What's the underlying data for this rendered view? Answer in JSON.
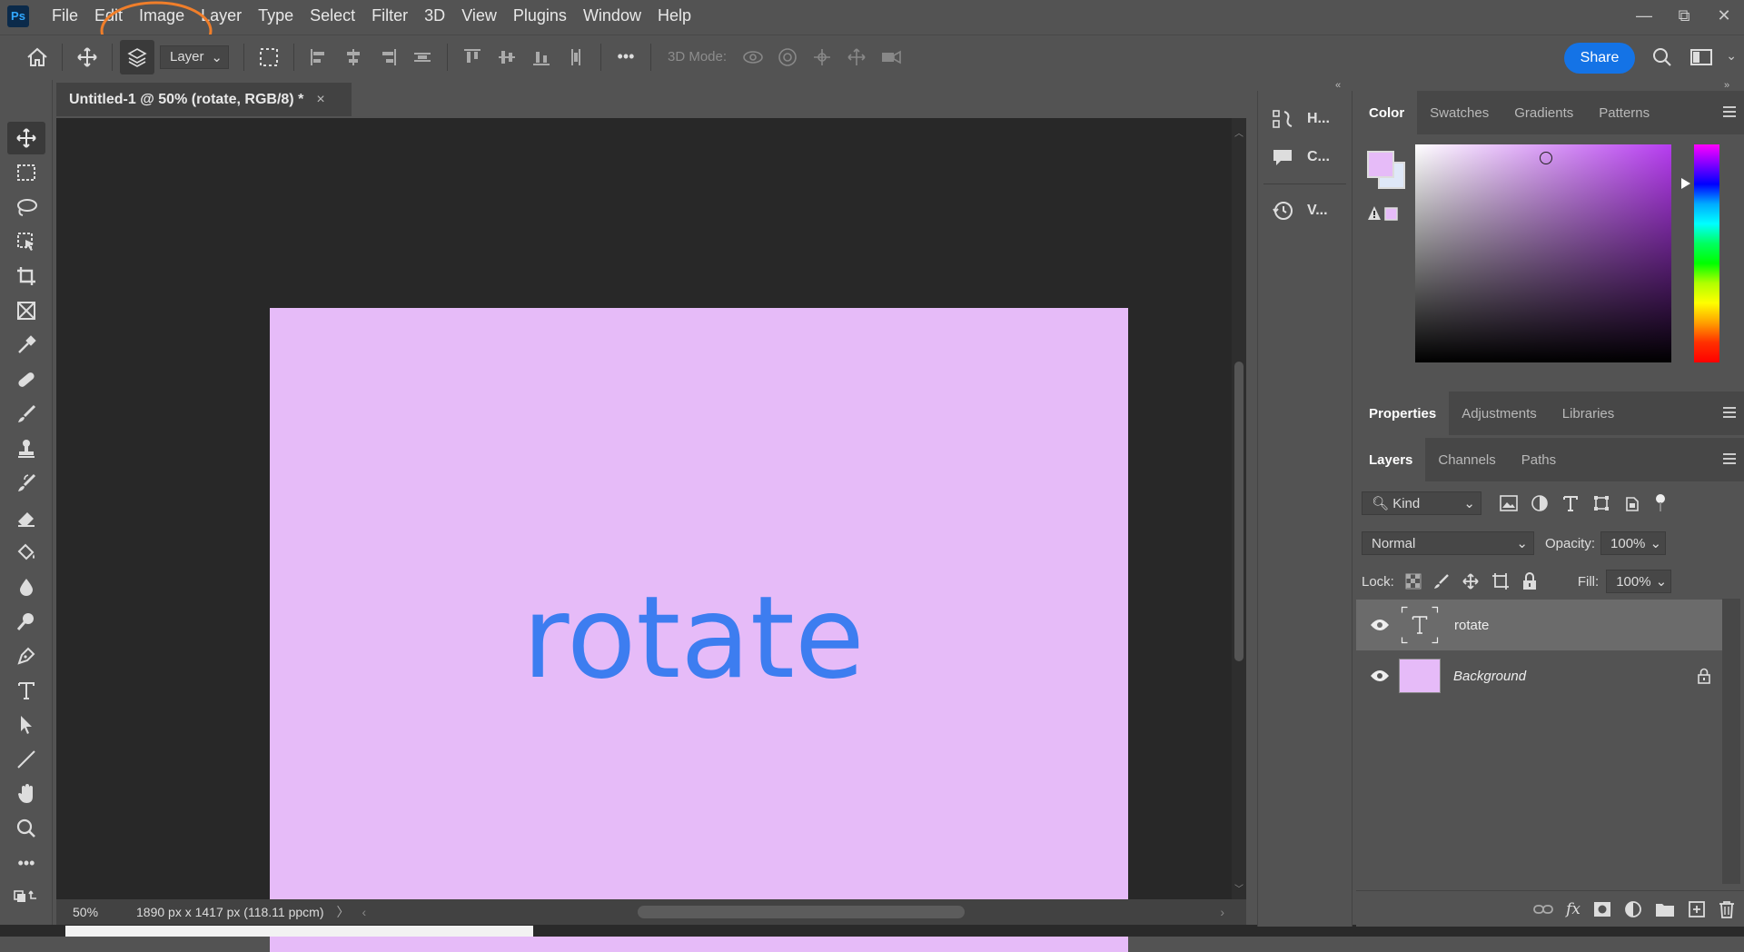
{
  "app": {
    "logo": "Ps"
  },
  "menu": [
    "File",
    "Edit",
    "Image",
    "Layer",
    "Type",
    "Select",
    "Filter",
    "3D",
    "View",
    "Plugins",
    "Window",
    "Help"
  ],
  "window_controls": {
    "minimize": "—",
    "restore": "⧉",
    "close": "✕"
  },
  "options": {
    "layer_select": "Layer",
    "mode_label": "3D Mode:",
    "more": "•••",
    "share": "Share"
  },
  "document": {
    "tab_title": "Untitled-1 @ 50% (rotate, RGB/8) *",
    "close": "×",
    "text": "rotate",
    "bg_color": "#e6bbf8",
    "text_color": "#3d7df0"
  },
  "status": {
    "zoom": "50%",
    "size": "1890 px x 1417 px (118.11 ppcm)",
    "arrow": "〉"
  },
  "panel_strip": [
    {
      "icon": "histogram-icon",
      "label": "H..."
    },
    {
      "icon": "comment-icon",
      "label": "C..."
    },
    {
      "icon": "history-icon",
      "label": "V..."
    }
  ],
  "color_panel": {
    "tabs": [
      "Color",
      "Swatches",
      "Gradients",
      "Patterns"
    ],
    "foreground": "#e6bbf8",
    "background": "#dfe8f8"
  },
  "properties_panel": {
    "tabs": [
      "Properties",
      "Adjustments",
      "Libraries"
    ]
  },
  "layers_panel": {
    "tabs": [
      "Layers",
      "Channels",
      "Paths"
    ],
    "filter_kind": "Kind",
    "blend_mode": "Normal",
    "opacity_label": "Opacity:",
    "opacity": "100%",
    "lock_label": "Lock:",
    "fill_label": "Fill:",
    "fill": "100%",
    "layers": [
      {
        "name": "rotate",
        "type": "text",
        "selected": true
      },
      {
        "name": "Background",
        "type": "pixel",
        "locked": true
      }
    ]
  }
}
